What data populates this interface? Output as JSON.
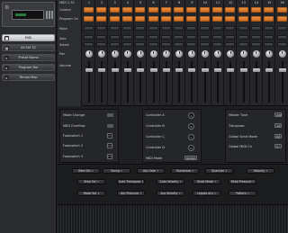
{
  "sidebar": {
    "device_name": "MIDI",
    "items": [
      {
        "label": "All Set 32",
        "icon": "grid-icon"
      },
      {
        "label": "Preset Name",
        "icon": "preset-icon"
      },
      {
        "label": "Program Bar",
        "icon": "program-icon"
      },
      {
        "label": "Tempo Map",
        "icon": "tempo-icon"
      }
    ]
  },
  "mixer": {
    "header_label": "MIDI 1-32",
    "row_labels": [
      "Control",
      "Program On",
      "Mute",
      "Solo",
      "Select",
      "Pan",
      "Volume"
    ],
    "channels": [
      "1",
      "2",
      "3",
      "4",
      "5",
      "6",
      "7",
      "8",
      "9",
      "10",
      "11",
      "12",
      "13",
      "14",
      "15",
      "16"
    ],
    "fader_levels": [
      0.82,
      0.82,
      0.82,
      0.82,
      0.82,
      0.82,
      0.82,
      0.82,
      0.82,
      0.82,
      0.82,
      0.82,
      0.82,
      0.82,
      0.82,
      0.82
    ]
  },
  "controls": {
    "col1": [
      {
        "label": "Mode Change",
        "control": "toggle"
      },
      {
        "label": "MIDI Overflow",
        "control": "toggle"
      },
      {
        "label": "Footswitch 1",
        "control": "box",
        "value": "F1"
      },
      {
        "label": "Footswitch 2",
        "control": "box",
        "value": "F2"
      },
      {
        "label": "Footswitch 3",
        "control": "box",
        "value": "F3"
      }
    ],
    "col2": [
      {
        "label": "Controller A",
        "value": "A"
      },
      {
        "label": "Controller B",
        "value": "B"
      },
      {
        "label": "Controller C",
        "value": "C"
      },
      {
        "label": "Controller D",
        "value": "D"
      },
      {
        "label": "MIDI Mode",
        "value": "Global"
      }
    ],
    "col3": [
      {
        "label": "Master Tune",
        "value": "440"
      },
      {
        "label": "Transpose",
        "value": "+0"
      },
      {
        "label": "Global Send Mode",
        "value": "All"
      },
      {
        "label": "Global MIDI Ch",
        "value": "1"
      }
    ]
  },
  "dropdowns": [
    [
      "Rate Div",
      "Swing",
      "Arp Gate",
      "Humanize",
      "Quantize",
      "Velocity"
    ],
    [
      "Step Sel",
      "Auto Transpose",
      "Auto Velocity",
      "Knob Mode",
      "Mute Pressure"
    ],
    [
      "Mode Sel",
      "Arp Pressure",
      "Arp Velocity",
      "Legato Arp",
      "Pattern"
    ]
  ],
  "colors": {
    "pad_orange": "#e08a3c",
    "panel_dark": "#1e1f21"
  }
}
